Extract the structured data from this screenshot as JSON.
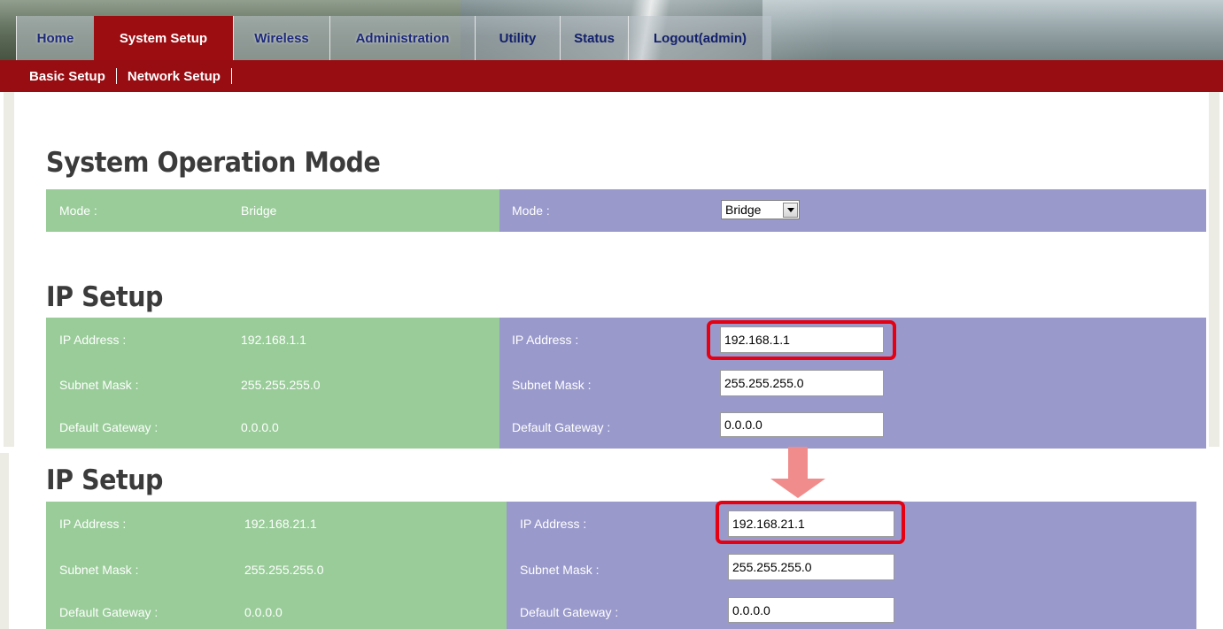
{
  "nav": {
    "tabs": [
      {
        "label": "Home",
        "active": false
      },
      {
        "label": "System Setup",
        "active": true
      },
      {
        "label": "Wireless",
        "active": false
      },
      {
        "label": "Administration",
        "active": false
      },
      {
        "label": "Utility",
        "active": false
      },
      {
        "label": "Status",
        "active": false
      },
      {
        "label": "Logout(admin)",
        "active": false
      }
    ]
  },
  "subnav": {
    "items": [
      {
        "label": "Basic Setup"
      },
      {
        "label": "Network Setup"
      }
    ]
  },
  "operation_mode": {
    "title": "System Operation Mode",
    "current": {
      "label": "Mode :",
      "value": "Bridge"
    },
    "edit": {
      "label": "Mode :",
      "selected": "Bridge"
    }
  },
  "ip_setup_before": {
    "title": "IP Setup",
    "current": [
      {
        "label": "IP Address :",
        "value": "192.168.1.1"
      },
      {
        "label": "Subnet Mask :",
        "value": "255.255.255.0"
      },
      {
        "label": "Default Gateway :",
        "value": "0.0.0.0"
      }
    ],
    "edit": [
      {
        "label": "IP Address :",
        "value": "192.168.1.1"
      },
      {
        "label": "Subnet Mask :",
        "value": "255.255.255.0"
      },
      {
        "label": "Default Gateway :",
        "value": "0.0.0.0"
      }
    ]
  },
  "ip_setup_after": {
    "title": "IP Setup",
    "current": [
      {
        "label": "IP Address :",
        "value": "192.168.21.1"
      },
      {
        "label": "Subnet Mask :",
        "value": "255.255.255.0"
      },
      {
        "label": "Default Gateway :",
        "value": "0.0.0.0"
      }
    ],
    "edit": [
      {
        "label": "IP Address :",
        "value": "192.168.21.1"
      },
      {
        "label": "Subnet Mask :",
        "value": "255.255.255.0"
      },
      {
        "label": "Default Gateway :",
        "value": "0.0.0.0"
      }
    ]
  },
  "colors": {
    "header_red": "#980d12",
    "green_panel": "#99cc99",
    "purple_panel": "#9999cc",
    "highlight_red": "#e50012",
    "arrow_pink": "#f08c8c"
  }
}
